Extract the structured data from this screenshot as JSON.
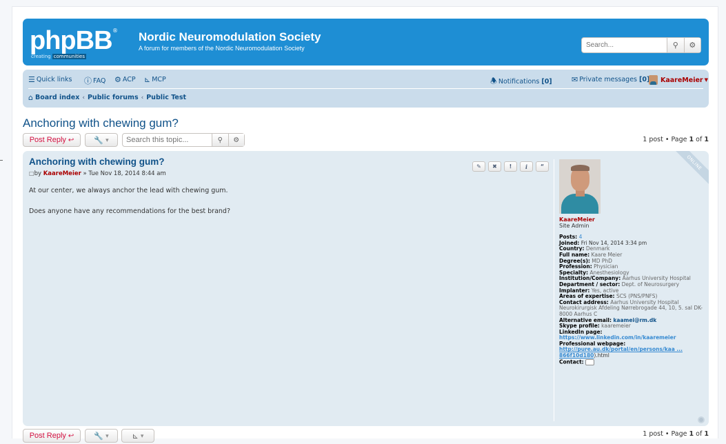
{
  "header": {
    "logo_text": "phpBB",
    "logo_reg": "®",
    "logo_tagline_1": "creating",
    "logo_tagline_2": "communities",
    "site_title": "Nordic Neuromodulation Society",
    "site_description": "A forum for members of the Nordic Neuromodulation Society",
    "search_placeholder": "Search..."
  },
  "nav": {
    "quick_links": "Quick links",
    "faq": "FAQ",
    "acp": "ACP",
    "mcp": "MCP",
    "notifications": "Notifications",
    "notifications_count": "[0]",
    "private_messages": "Private messages",
    "pm_count": "[0]",
    "username": "KaareMeier",
    "breadcrumbs": [
      "Board index",
      "Public forums",
      "Public Test"
    ]
  },
  "topic": {
    "title": "Anchoring with chewing gum?",
    "post_reply": "Post Reply",
    "search_placeholder": "Search this topic...",
    "pagination_prefix": "1 post • Page",
    "page_current": "1",
    "page_of": "of",
    "page_total": "1"
  },
  "post": {
    "title": "Anchoring with chewing gum?",
    "by": "by",
    "author": "KaareMeier",
    "date": "» Tue Nov 18, 2014 8:44 am",
    "body": [
      "At our center, we always anchor the lead with chewing gum.",
      "Does anyone have any recommendations for the best brand?"
    ],
    "online_label": "ONLINE"
  },
  "profile": {
    "name": "KaareMeier",
    "rank": "Site Admin",
    "fields": [
      {
        "label": "Posts:",
        "value": "4",
        "type": "link"
      },
      {
        "label": "Joined:",
        "value": "Fri Nov 14, 2014 3:34 pm"
      },
      {
        "label": "Country:",
        "value": "Denmark"
      },
      {
        "label": "Full name:",
        "value": "Kaare Meier"
      },
      {
        "label": "Degree(s):",
        "value": "MD PhD"
      },
      {
        "label": "Profession:",
        "value": "Physician"
      },
      {
        "label": "Specialty:",
        "value": "Anesthesiology"
      },
      {
        "label": "Institution/Company:",
        "value": "Aarhus University Hospital"
      },
      {
        "label": "Department / sector:",
        "value": "Dept. of Neurosurgery"
      },
      {
        "label": "Implanter:",
        "value": "Yes, active"
      },
      {
        "label": "Areas of expertise:",
        "value": "SCS (PNS/PNFS)"
      },
      {
        "label": "Contact address:",
        "value": "Aarhus University Hospital Neurokirurgisk Afdeling Nørrebrogade 44, 10, 5. sal DK-8000 Aarhus C"
      },
      {
        "label": "Alternative email:",
        "value": "kaamei@rm.dk",
        "type": "bold"
      },
      {
        "label": "Skype profile:",
        "value": "kaaremeier"
      },
      {
        "label": "LinkedIn page:",
        "value": "https://www.linkedin.com/in/kaaremeier",
        "type": "link"
      },
      {
        "label": "Professional webpage:",
        "value": "http://pure.au.dk/portal/en/persons/kaa ... 866f10d180",
        "suffix": ").html",
        "type": "link"
      },
      {
        "label": "Contact:",
        "value": ""
      }
    ]
  },
  "colors": {
    "header_blue": "#1e8ed4",
    "navbar_bg": "#cadceb",
    "post_bg": "#e1ebf2",
    "link": "#105289",
    "admin_red": "#aa0000",
    "reply_red": "#d31141"
  }
}
